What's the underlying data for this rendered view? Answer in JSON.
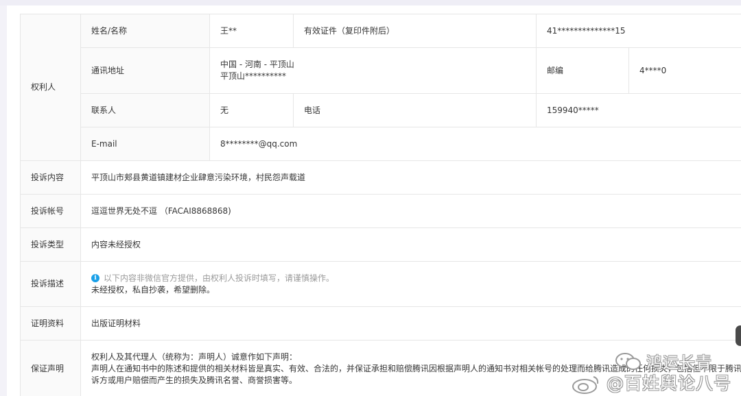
{
  "owner": {
    "section_label": "权利人",
    "name_label": "姓名/名称",
    "name_value": "王**",
    "id_label": "有效证件（复印件附后）",
    "id_value": "41**************15",
    "address_label": "通讯地址",
    "address_line1": "中国 - 河南 - 平顶山",
    "address_line2": "平顶山**********",
    "postcode_label": "邮编",
    "postcode_value": "4****0",
    "contact_label": "联系人",
    "contact_value": "无",
    "phone_label": "电话",
    "phone_value": "159940*****",
    "email_label": "E-mail",
    "email_value": "8********@qq.com"
  },
  "complaint_content": {
    "label": "投诉内容",
    "value": "平顶山市郏县黄道镇建材企业肆意污染环境，村民怨声载道"
  },
  "complaint_account": {
    "label": "投诉帐号",
    "value": "逗逗世界无处不逗 （FACAI8868868)"
  },
  "complaint_type": {
    "label": "投诉类型",
    "value": "内容未经授权"
  },
  "complaint_description": {
    "label": "投诉描述",
    "notice_icon": "info-icon",
    "notice": "以下内容非微信官方提供，由权利人投诉时填写，请谨慎操作。",
    "text": "未经授权，私自抄袭，希望删除。"
  },
  "proof": {
    "label": "证明资料",
    "value": "出版证明材料"
  },
  "guarantee": {
    "label": "保证声明",
    "line1": "权利人及其代理人（统称为：声明人）诚意作如下声明：",
    "line2": "声明人在通知书中的陈述和提供的相关材料皆是真实、有效、合法的，并保证承担和赔偿腾讯因根据声明人的通知书对相关帐号的处理而给腾讯造成的任何损失，包括但不限于腾讯因向被投",
    "line3": "诉方或用户赔偿而产生的损失及腾讯名誉、商誉损害等。"
  },
  "watermark": {
    "line1": "鸿运长青",
    "line2": "@百姓舆论八号",
    "icon1": "wechat-icon",
    "icon2": "weibo-icon"
  },
  "colors": {
    "info_icon": "#1aa0e8",
    "label_background": "#fafafa",
    "border": "#e6e6e6",
    "text": "#353535"
  }
}
